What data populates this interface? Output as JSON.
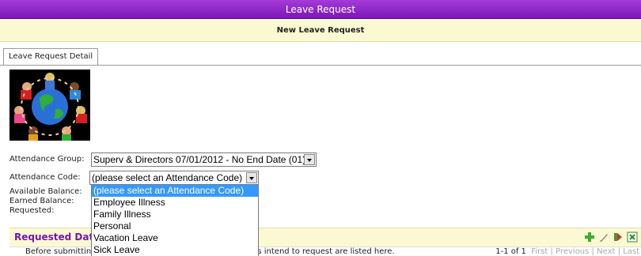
{
  "window": {
    "title": "Leave Request"
  },
  "subheader": {
    "title": "New Leave Request"
  },
  "tabs": [
    {
      "label": "Leave Request Detail"
    }
  ],
  "form": {
    "attendance_group": {
      "label": "Attendance Group:",
      "value": "Superv & Directors 07/01/2012 - No End Date (01)"
    },
    "attendance_code": {
      "label": "Attendance Code:",
      "value": "(please select an Attendance Code)"
    },
    "available_balance": {
      "label": "Available Balance:"
    },
    "earned_balance": {
      "label": "Earned Balance:"
    },
    "requested": {
      "label": "Requested:"
    }
  },
  "dropdown": {
    "options": [
      "(please select an Attendance Code)",
      "Employee Illness",
      "Family Illness",
      "Personal",
      "Vacation Leave",
      "Sick Leave"
    ],
    "selected_index": 0
  },
  "requested_dates": {
    "title": "Requested Dat",
    "info": "Before submittin",
    "info_tail": "rs intend to request are listed here.",
    "pager": {
      "range": "1-1 of 1",
      "first": "First",
      "previous": "Previous",
      "next": "Next",
      "last": "Last"
    }
  },
  "icons": [
    "add-icon",
    "edit-icon",
    "export-icon",
    "excel-icon"
  ],
  "colors": {
    "title_bar": "#8a22c4",
    "subheader_bg": "#fbf9d2",
    "section_title": "#7a12b5",
    "selection": "#3399ff"
  }
}
